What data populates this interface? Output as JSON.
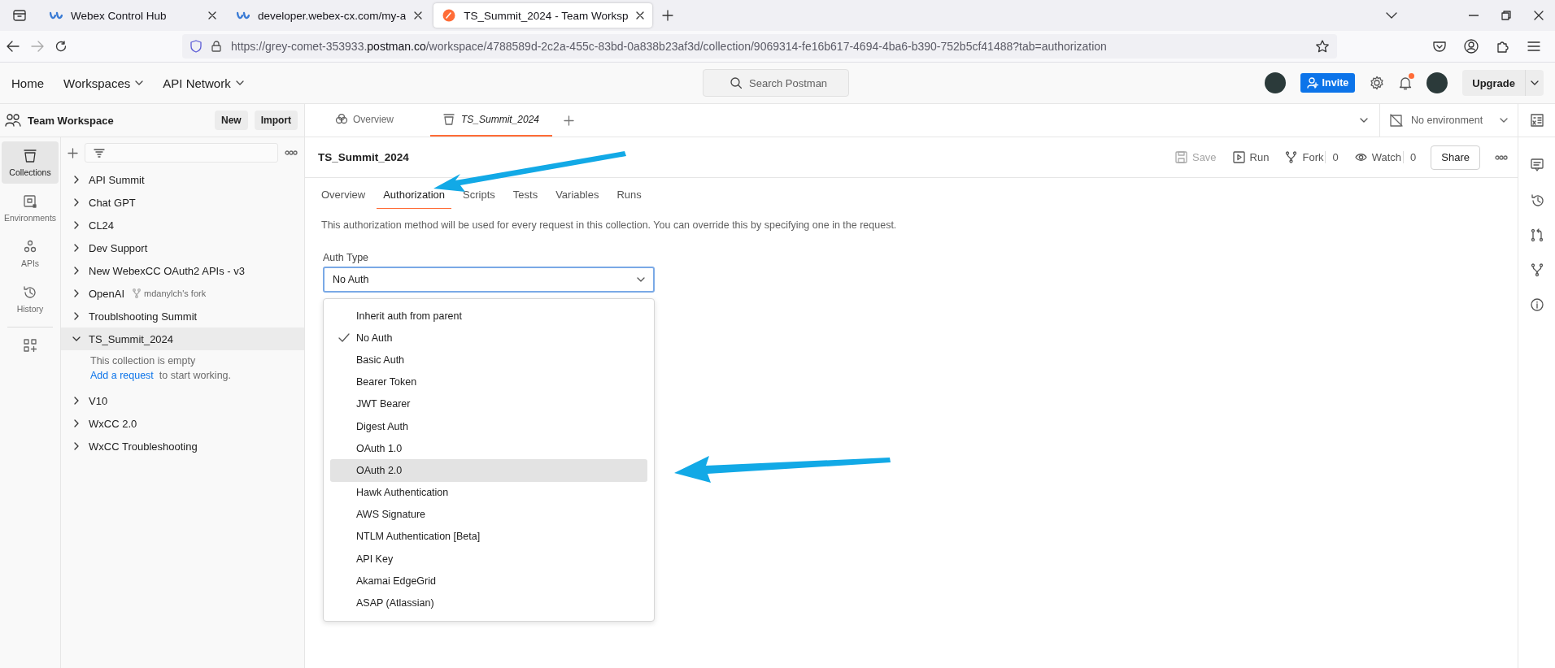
{
  "browser": {
    "tabs": [
      {
        "title": "Webex Control Hub",
        "kind": "webex",
        "selected": false
      },
      {
        "title": "developer.webex-cx.com/my-a",
        "kind": "webex",
        "selected": false
      },
      {
        "title": "TS_Summit_2024 - Team Worksp",
        "kind": "postman",
        "selected": true
      }
    ],
    "url": "https://grey-comet-353933.**postman.co**/workspace/4788589d-2c2a-455c-83bd-0a838b23af3d/collection/9069314-fe16b617-4694-4ba6-b390-752b5cf41488?tab=authorization"
  },
  "app_header": {
    "nav": [
      {
        "label": "Home",
        "menu": false
      },
      {
        "label": "Workspaces",
        "menu": true
      },
      {
        "label": "API Network",
        "menu": true
      }
    ],
    "search": {
      "placeholder": "Search Postman"
    },
    "invite": "Invite",
    "notifications_unread": true,
    "upgrade": "Upgrade"
  },
  "workspace": {
    "name": "Team Workspace",
    "buttons": [
      "New",
      "Import"
    ]
  },
  "rail": [
    {
      "label": "Collections",
      "kind": "collections",
      "selected": true
    },
    {
      "label": "Environments",
      "kind": "environments",
      "selected": false
    },
    {
      "label": "APIs",
      "kind": "apis",
      "selected": false
    },
    {
      "label": "History",
      "kind": "history",
      "selected": false
    }
  ],
  "collections": [
    {
      "name": "API Summit",
      "expanded": false,
      "selected": false
    },
    {
      "name": "Chat GPT",
      "expanded": false,
      "selected": false
    },
    {
      "name": "CL24",
      "expanded": false,
      "selected": false
    },
    {
      "name": "Dev Support",
      "expanded": false,
      "selected": false
    },
    {
      "name": "New WebexCC OAuth2 APIs - v3",
      "expanded": false,
      "selected": false
    },
    {
      "name": "OpenAI",
      "fork": "mdanylch's fork",
      "expanded": false,
      "selected": false
    },
    {
      "name": "Troublshooting Summit",
      "expanded": false,
      "selected": false
    },
    {
      "name": "TS_Summit_2024",
      "expanded": true,
      "selected": true,
      "empty_message": "This collection is empty",
      "empty_link": "Add a request",
      "empty_suffix": "to start working."
    },
    {
      "name": "V10",
      "expanded": false,
      "selected": false
    },
    {
      "name": "WxCC 2.0",
      "expanded": false,
      "selected": false
    },
    {
      "name": "WxCC Troubleshooting",
      "expanded": false,
      "selected": false
    }
  ],
  "main_tabs": [
    {
      "label": "Overview",
      "kind": "overview",
      "selected": false
    },
    {
      "label": "TS_Summit_2024",
      "kind": "collection",
      "selected": true
    }
  ],
  "environment": "No environment",
  "collection": {
    "title": "TS_Summit_2024",
    "actions": [
      {
        "label": "Save",
        "kind": "save",
        "disabled": true
      },
      {
        "label": "Run",
        "kind": "run",
        "disabled": false
      },
      {
        "label": "Fork",
        "kind": "fork",
        "count": "0",
        "disabled": false
      },
      {
        "label": "Watch",
        "kind": "watch",
        "count": "0",
        "disabled": false
      }
    ],
    "share": "Share"
  },
  "subtabs": [
    {
      "label": "Overview",
      "selected": false
    },
    {
      "label": "Authorization",
      "selected": true
    },
    {
      "label": "Scripts",
      "selected": false
    },
    {
      "label": "Tests",
      "selected": false
    },
    {
      "label": "Variables",
      "selected": false
    },
    {
      "label": "Runs",
      "selected": false
    }
  ],
  "description": "This authorization method will be used for every request in this collection. You can override this by specifying one in the request.",
  "auth": {
    "label": "Auth Type",
    "value": "No Auth",
    "open": true,
    "options": [
      {
        "label": "Inherit auth from parent",
        "selected": false,
        "highlighted": false
      },
      {
        "label": "No Auth",
        "selected": true,
        "highlighted": false
      },
      {
        "label": "Basic Auth",
        "selected": false,
        "highlighted": false
      },
      {
        "label": "Bearer Token",
        "selected": false,
        "highlighted": false
      },
      {
        "label": "JWT Bearer",
        "selected": false,
        "highlighted": false
      },
      {
        "label": "Digest Auth",
        "selected": false,
        "highlighted": false
      },
      {
        "label": "OAuth 1.0",
        "selected": false,
        "highlighted": false
      },
      {
        "label": "OAuth 2.0",
        "selected": false,
        "highlighted": true
      },
      {
        "label": "Hawk Authentication",
        "selected": false,
        "highlighted": false
      },
      {
        "label": "AWS Signature",
        "selected": false,
        "highlighted": false
      },
      {
        "label": "NTLM Authentication [Beta]",
        "selected": false,
        "highlighted": false
      },
      {
        "label": "API Key",
        "selected": false,
        "highlighted": false
      },
      {
        "label": "Akamai EdgeGrid",
        "selected": false,
        "highlighted": false
      },
      {
        "label": "ASAP (Atlassian)",
        "selected": false,
        "highlighted": false
      }
    ]
  }
}
